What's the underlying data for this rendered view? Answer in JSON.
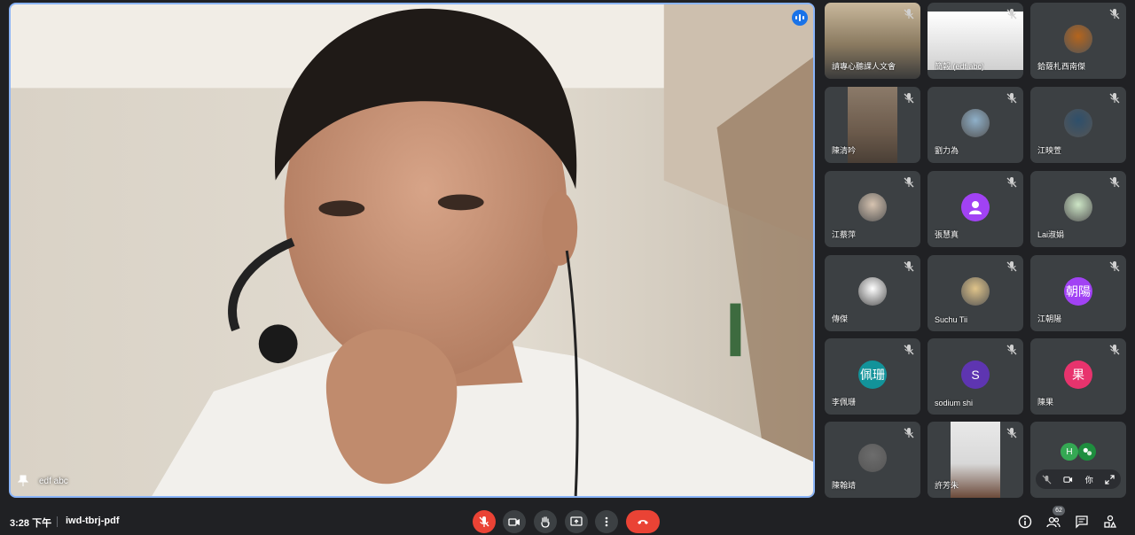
{
  "meeting": {
    "time": "3:28 下午",
    "code": "iwd-tbrj-pdf"
  },
  "main_speaker": {
    "name": "edf abc",
    "speaking": true
  },
  "tiles": [
    {
      "name": "請專心聽課人文會",
      "kind": "video",
      "muted": true
    },
    {
      "name": "簡報 (edf abc)",
      "kind": "screen",
      "muted": true
    },
    {
      "name": "鉿薩札西南傑",
      "kind": "photo",
      "muted": true,
      "color": "#b5651d"
    },
    {
      "name": "陳清吟",
      "kind": "video",
      "muted": true
    },
    {
      "name": "劉力為",
      "kind": "photo",
      "muted": true,
      "color": "#8fb0c9"
    },
    {
      "name": "江映萱",
      "kind": "photo",
      "muted": true,
      "color": "#2e4f6b"
    },
    {
      "name": "江蔡萍",
      "kind": "photo",
      "muted": true,
      "color": "#d6c3b0"
    },
    {
      "name": "張慧真",
      "kind": "default",
      "muted": true,
      "color": "#a142f4"
    },
    {
      "name": "Lai淑娟",
      "kind": "photo",
      "muted": true,
      "color": "#cde6c6"
    },
    {
      "name": "傳傑",
      "kind": "photo",
      "muted": true,
      "color": "#ffffff"
    },
    {
      "name": "Suchu Tii",
      "kind": "photo",
      "muted": true,
      "color": "#e0c48a"
    },
    {
      "name": "江朝陽",
      "kind": "letter",
      "letter": "朝陽",
      "muted": true,
      "color": "#a142f4"
    },
    {
      "name": "李佩珊",
      "kind": "letter",
      "letter": "佩珊",
      "muted": true,
      "color": "#12939a"
    },
    {
      "name": "sodium shi",
      "kind": "letter",
      "letter": "S",
      "muted": true,
      "color": "#5e35b1"
    },
    {
      "name": "陳果",
      "kind": "letter",
      "letter": "果",
      "muted": true,
      "color": "#e8336d"
    },
    {
      "name": "陳翰靖",
      "kind": "photo",
      "muted": true,
      "color": "#6d6d6d"
    },
    {
      "name": "許芳朱",
      "kind": "video",
      "muted": true
    }
  ],
  "self_tile": {
    "you_label": "你",
    "avatars": [
      {
        "letter": "H",
        "color": "#34a853"
      },
      {
        "letter": "",
        "color": "#1e8e3e"
      }
    ]
  },
  "participants_count": "62",
  "icons": {
    "mic_off": "mic-off-icon",
    "camera": "camera-icon",
    "raise_hand": "raise-hand-icon",
    "present": "present-icon",
    "more": "more-options-icon",
    "hang_up": "hang-up-icon",
    "info": "info-icon",
    "people": "people-icon",
    "chat": "chat-icon",
    "activities": "activities-icon"
  },
  "colors": {
    "accent": "#8ab4f8",
    "danger": "#ea4335",
    "tile_bg": "#3c4043",
    "page_bg": "#202124"
  }
}
